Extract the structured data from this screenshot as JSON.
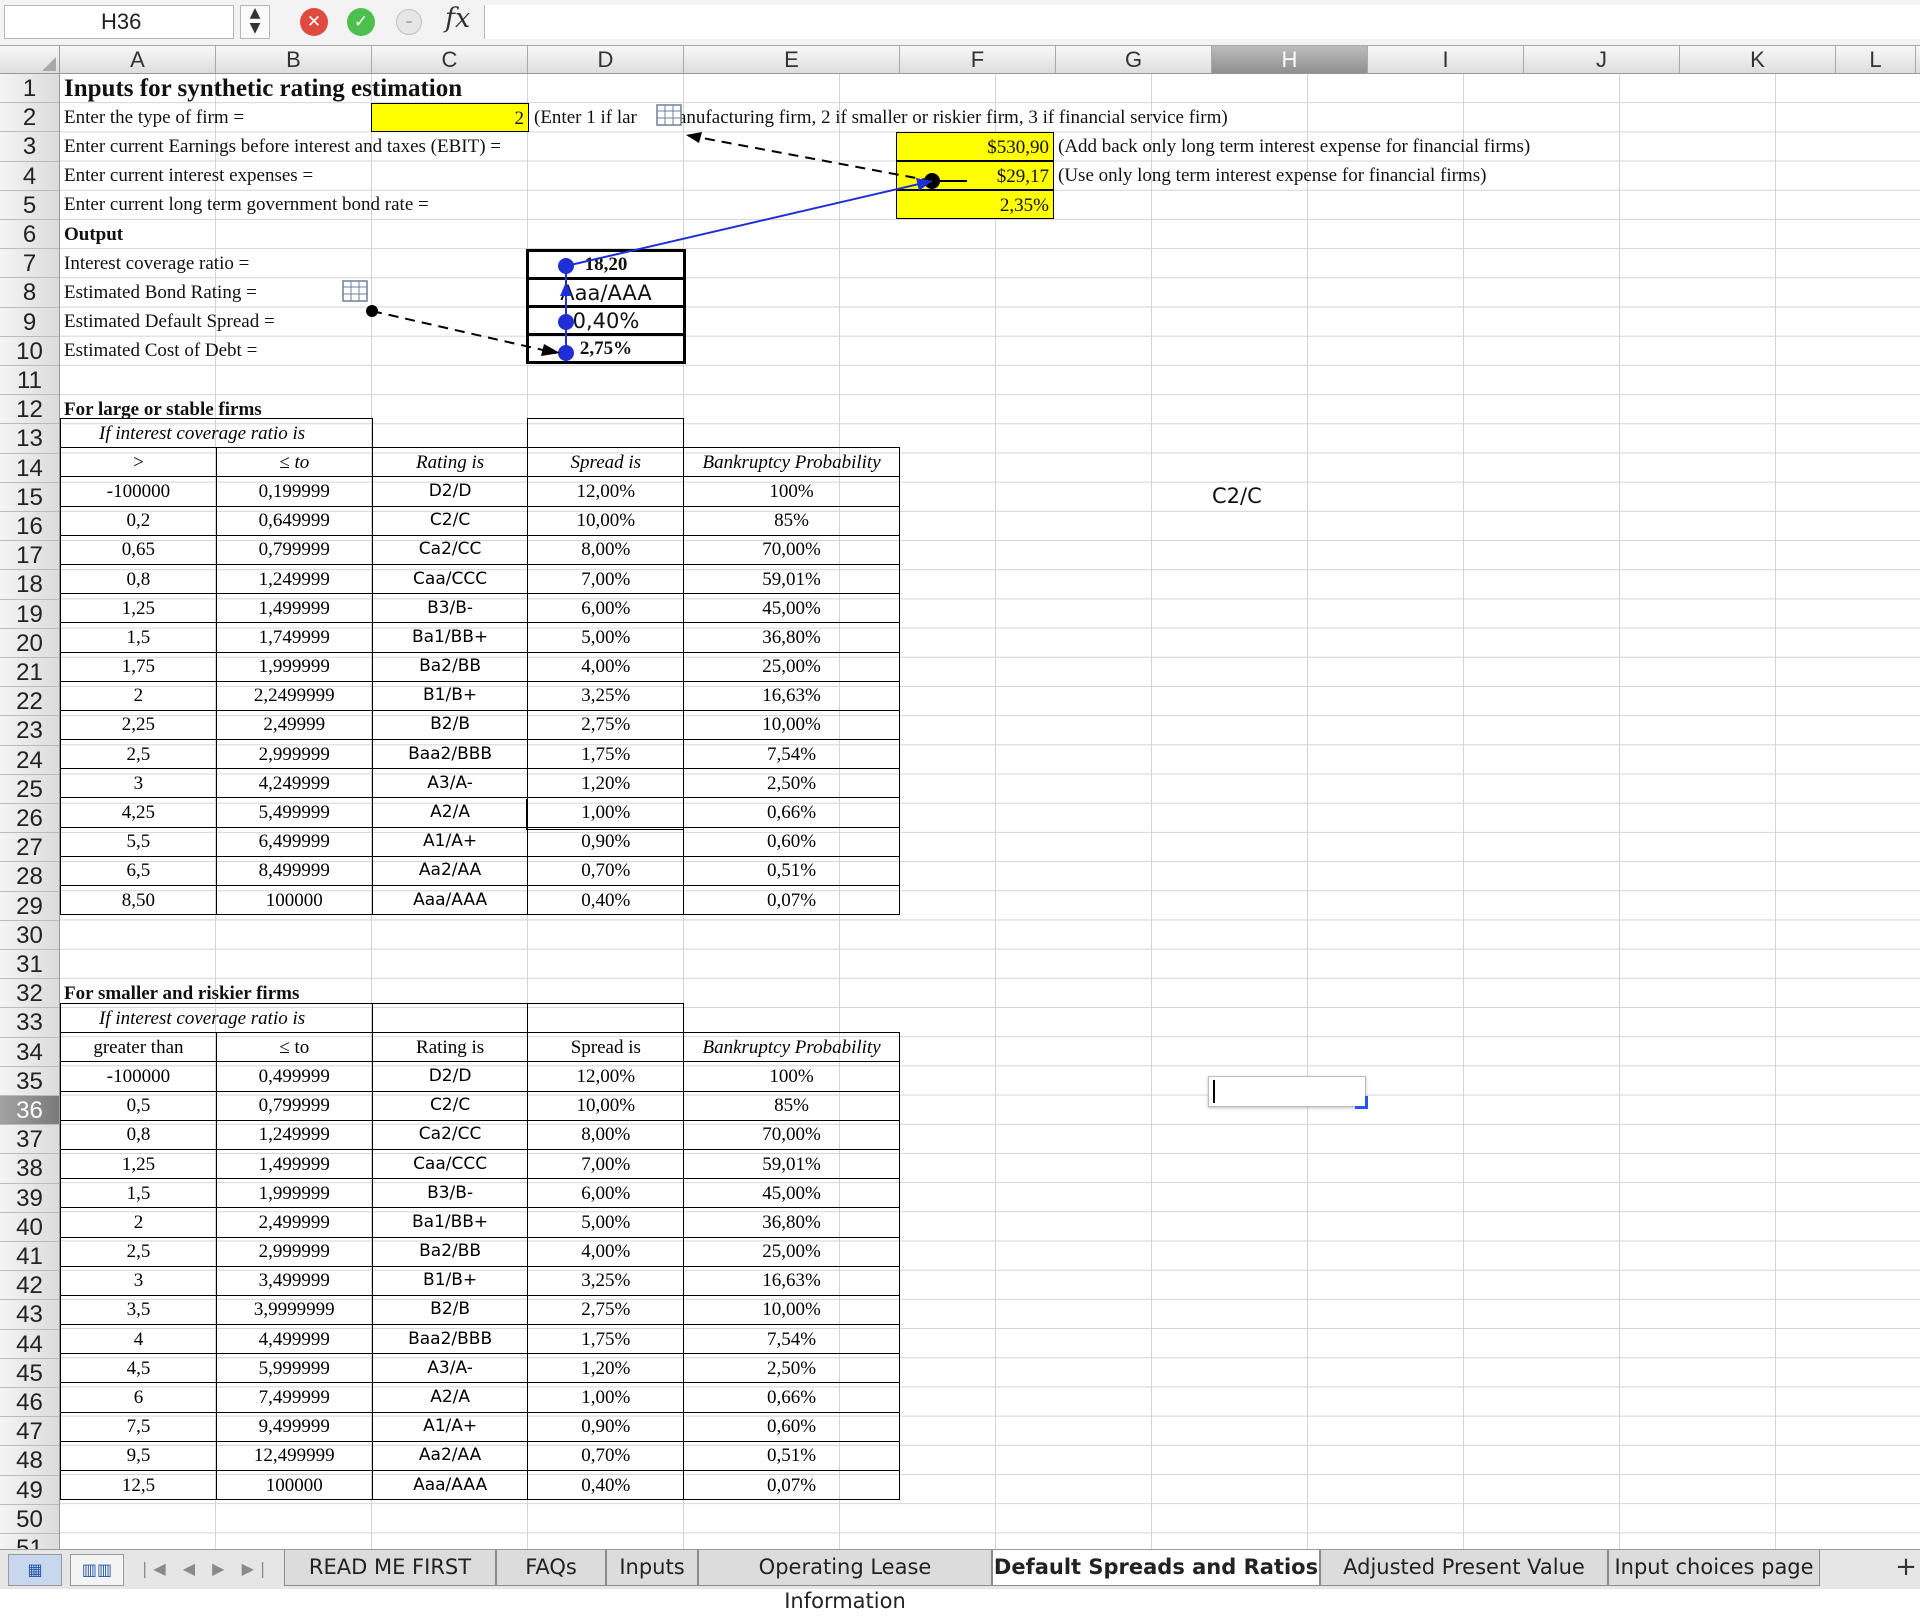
{
  "formula_bar": {
    "name_box": "H36",
    "name_dropdown_icon": "up-down-arrows-icon",
    "cancel_icon": "cancel-x-icon",
    "enter_icon": "checkmark-icon",
    "function_icon": "function-circle-icon",
    "fx_label": "fx",
    "formula": ""
  },
  "columns": [
    "A",
    "B",
    "C",
    "D",
    "E",
    "F",
    "G",
    "H",
    "I",
    "J",
    "K",
    "L"
  ],
  "selected_column": "H",
  "rows": [
    1,
    2,
    3,
    4,
    5,
    6,
    7,
    8,
    9,
    10,
    11,
    12,
    13,
    14,
    15,
    16,
    17,
    18,
    19,
    20,
    21,
    22,
    23,
    24,
    25,
    26,
    27,
    28,
    29,
    30,
    31,
    32,
    33,
    34,
    35,
    36,
    37,
    38,
    39,
    40,
    41,
    42,
    43,
    44,
    45,
    46,
    47,
    48,
    49,
    50,
    51
  ],
  "selected_row": 36,
  "inputs": {
    "title": "Inputs for synthetic rating estimation",
    "firm_type_label": "Enter the type of firm =",
    "firm_type_value": "2",
    "firm_type_note": "(Enter 1 if lar",
    "firm_type_note_cont": "anufacturing firm, 2 if smaller or riskier firm, 3 if financial service firm)",
    "ebit_label": "Enter current Earnings before interest and taxes (EBIT) =",
    "ebit_value": "$530,90",
    "ebit_note": "(Add back only long term interest expense for financial firms)",
    "interest_label": "Enter current interest expenses =",
    "interest_value": "$29,17",
    "interest_note": "(Use only long term interest expense for financial firms)",
    "bond_rate_label": "Enter current long term government bond rate =",
    "bond_rate_value": "2,35%"
  },
  "output": {
    "heading": "Output",
    "coverage_label": "Interest  coverage ratio =",
    "coverage_value": "18,20",
    "rating_label": "Estimated Bond Rating =",
    "rating_value": "Aaa/AAA",
    "spread_label": "Estimated Default Spread =",
    "spread_value": "0,40%",
    "cost_label": "Estimated Cost of Debt =",
    "cost_value": "2,75%"
  },
  "large_firms": {
    "heading": "For large or stable firms",
    "subheading": "If interest coverage ratio is",
    "headers": [
      ">",
      "≤ to",
      "Rating is",
      "Spread is",
      "Bankruptcy Probability"
    ],
    "rows": [
      [
        "-100000",
        "0,199999",
        "D2/D",
        "12,00%",
        "100%"
      ],
      [
        "0,2",
        "0,649999",
        "C2/C",
        "10,00%",
        "85%"
      ],
      [
        "0,65",
        "0,799999",
        "Ca2/CC",
        "8,00%",
        "70,00%"
      ],
      [
        "0,8",
        "1,249999",
        "Caa/CCC",
        "7,00%",
        "59,01%"
      ],
      [
        "1,25",
        "1,499999",
        "B3/B-",
        "6,00%",
        "45,00%"
      ],
      [
        "1,5",
        "1,749999",
        "Ba1/BB+",
        "5,00%",
        "36,80%"
      ],
      [
        "1,75",
        "1,999999",
        "Ba2/BB",
        "4,00%",
        "25,00%"
      ],
      [
        "2",
        "2,2499999",
        "B1/B+",
        "3,25%",
        "16,63%"
      ],
      [
        "2,25",
        "2,49999",
        "B2/B",
        "2,75%",
        "10,00%"
      ],
      [
        "2,5",
        "2,999999",
        "Baa2/BBB",
        "1,75%",
        "7,54%"
      ],
      [
        "3",
        "4,249999",
        "A3/A-",
        "1,20%",
        "2,50%"
      ],
      [
        "4,25",
        "5,499999",
        "A2/A",
        "1,00%",
        "0,66%"
      ],
      [
        "5,5",
        "6,499999",
        "A1/A+",
        "0,90%",
        "0,60%"
      ],
      [
        "6,5",
        "8,499999",
        "Aa2/AA",
        "0,70%",
        "0,51%"
      ],
      [
        "8,50",
        "100000",
        "Aaa/AAA",
        "0,40%",
        "0,07%"
      ]
    ]
  },
  "small_firms": {
    "heading": "For smaller and riskier firms",
    "subheading": "If interest coverage ratio is",
    "headers": [
      "greater than",
      "≤ to",
      "Rating is",
      "Spread is",
      "Bankruptcy Probability"
    ],
    "rows": [
      [
        "-100000",
        "0,499999",
        "D2/D",
        "12,00%",
        "100%"
      ],
      [
        "0,5",
        "0,799999",
        "C2/C",
        "10,00%",
        "85%"
      ],
      [
        "0,8",
        "1,249999",
        "Ca2/CC",
        "8,00%",
        "70,00%"
      ],
      [
        "1,25",
        "1,499999",
        "Caa/CCC",
        "7,00%",
        "59,01%"
      ],
      [
        "1,5",
        "1,999999",
        "B3/B-",
        "6,00%",
        "45,00%"
      ],
      [
        "2",
        "2,499999",
        "Ba1/BB+",
        "5,00%",
        "36,80%"
      ],
      [
        "2,5",
        "2,999999",
        "Ba2/BB",
        "4,00%",
        "25,00%"
      ],
      [
        "3",
        "3,499999",
        "B1/B+",
        "3,25%",
        "16,63%"
      ],
      [
        "3,5",
        "3,9999999",
        "B2/B",
        "2,75%",
        "10,00%"
      ],
      [
        "4",
        "4,499999",
        "Baa2/BBB",
        "1,75%",
        "7,54%"
      ],
      [
        "4,5",
        "5,999999",
        "A3/A-",
        "1,20%",
        "2,50%"
      ],
      [
        "6",
        "7,499999",
        "A2/A",
        "1,00%",
        "0,66%"
      ],
      [
        "7,5",
        "9,499999",
        "A1/A+",
        "0,90%",
        "0,60%"
      ],
      [
        "9,5",
        "12,499999",
        "Aa2/AA",
        "0,70%",
        "0,51%"
      ],
      [
        "12,5",
        "100000",
        "Aaa/AAA",
        "0,40%",
        "0,07%"
      ]
    ]
  },
  "h18_value": "C2/C",
  "comment_icon": "comment-grid-icon",
  "sheet_tabs": {
    "nav_icon": "sheet-navigation-arrows-icon",
    "nav_arrows": "|◀ ◀ ▶ ▶|",
    "normal_view_icon": "normal-view-icon",
    "page_view_icon": "page-layout-view-icon",
    "add_icon": "plus-icon",
    "add_label": "+",
    "tabs": [
      "READ ME FIRST",
      "FAQs",
      "Inputs",
      "Operating Lease Information",
      "Default Spreads and Ratios",
      "Adjusted Present Value",
      "Input choices page"
    ],
    "active": "Default Spreads and Ratios"
  },
  "colors": {
    "input_fill": "#ffff00",
    "precedent_arrow": "#1f2fd6",
    "dependent_arrow": "#000000",
    "selection_header": "#8f8f8f"
  }
}
